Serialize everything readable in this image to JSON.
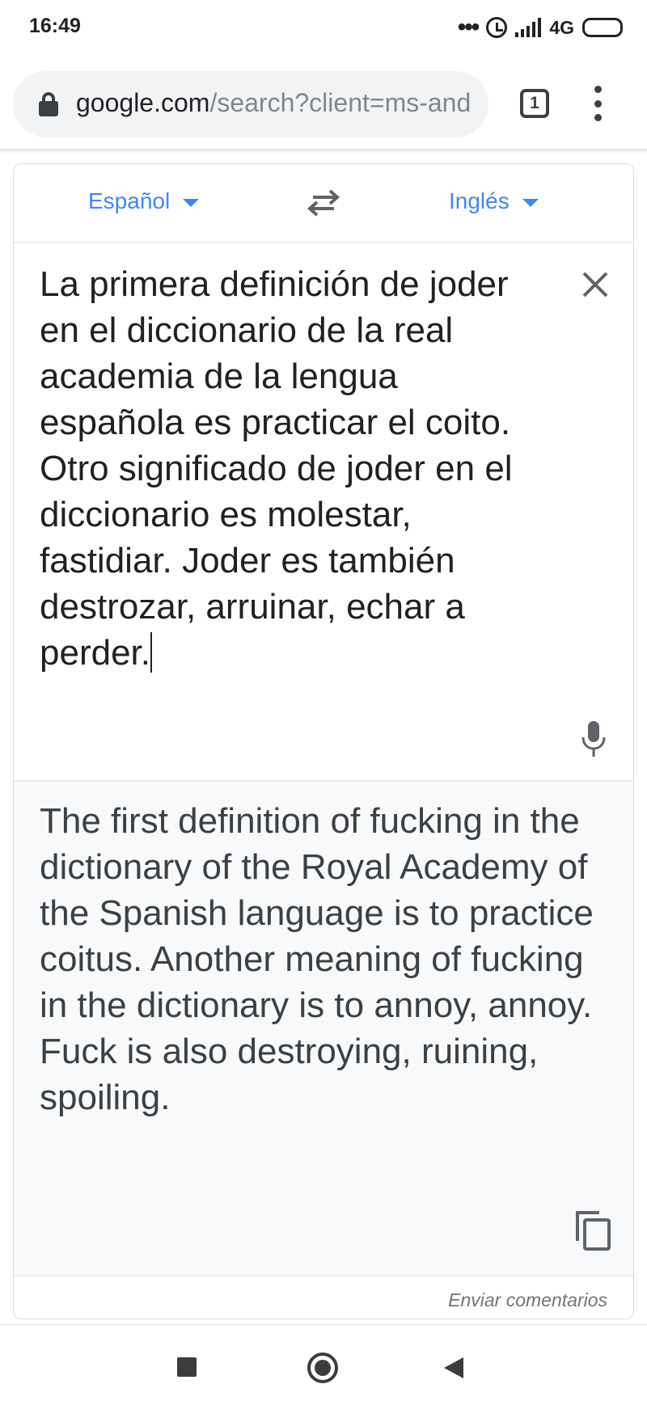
{
  "status_bar": {
    "time": "16:49",
    "dots": "•••",
    "network": "4G",
    "icons": [
      "alarm-icon",
      "signal-icon",
      "battery-icon"
    ]
  },
  "browser": {
    "url_host": "google.com",
    "url_path": "/search?client=ms-and",
    "tab_count": "1",
    "icons": [
      "lock-icon",
      "tabs-icon",
      "menu-icon"
    ]
  },
  "translate": {
    "source_language": "Español",
    "target_language": "Inglés",
    "source_text": "La primera definición de joder en el diccionario de la real academia de la lengua española es practicar el coito. Otro significado de joder en el diccionario es molestar, fastidiar. Joder es también destrozar, arruinar, echar a perder.",
    "translated_text": "The first definition of fucking in the dictionary of the Royal Academy of the Spanish language is to practice coitus. Another meaning of fucking in the dictionary is to annoy, annoy. Fuck is also destroying, ruining, spoiling.",
    "feedback_label": "Enviar comentarios",
    "icons": [
      "swap-icon",
      "close-icon",
      "mic-icon",
      "copy-icon"
    ]
  },
  "colors": {
    "accent": "#4285f4",
    "text": "#202124",
    "translation_bg": "#f8f9fa"
  },
  "nav_bar": {
    "icons": [
      "recent-apps-icon",
      "home-icon",
      "back-icon"
    ]
  }
}
